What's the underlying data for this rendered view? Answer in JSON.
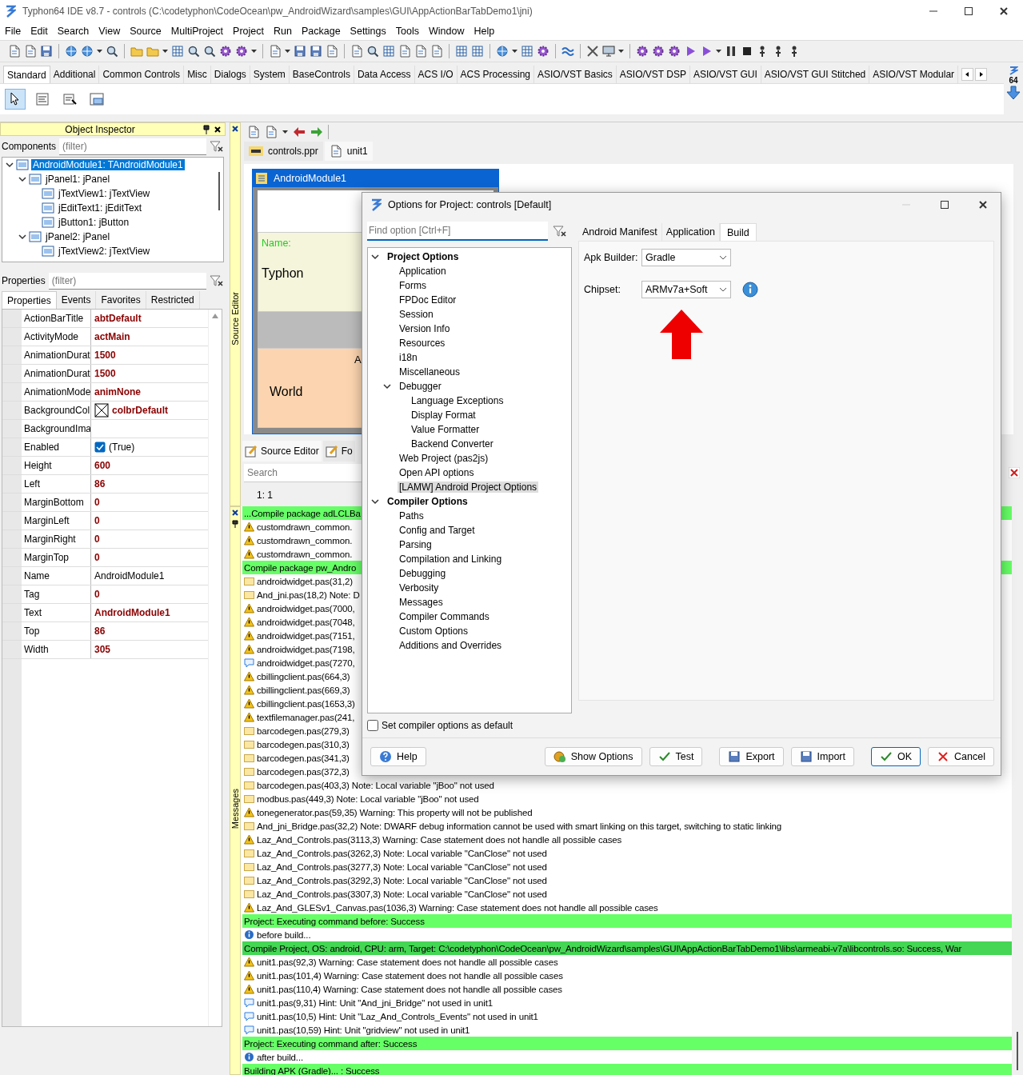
{
  "window": {
    "title": "Typhon64 IDE v8.7 - controls (C:\\codetyphon\\CodeOcean\\pw_AndroidWizard\\samples\\GUI\\AppActionBarTabDemo1\\jni)"
  },
  "menu": [
    "File",
    "Edit",
    "Search",
    "View",
    "Source",
    "MultiProject",
    "Project",
    "Run",
    "Package",
    "Settings",
    "Tools",
    "Window",
    "Help"
  ],
  "palette": {
    "tabs": [
      {
        "label": "Standard",
        "selected": true
      },
      {
        "label": "Additional",
        "selected": false
      },
      {
        "label": "Common Controls",
        "selected": false
      },
      {
        "label": "Misc",
        "selected": false
      },
      {
        "label": "Dialogs",
        "selected": false
      },
      {
        "label": "System",
        "selected": false
      },
      {
        "label": "BaseControls",
        "selected": false
      },
      {
        "label": "Data Access",
        "selected": false
      },
      {
        "label": "ACS I/O",
        "selected": false
      },
      {
        "label": "ACS Processing",
        "selected": false
      },
      {
        "label": "ASIO/VST Basics",
        "selected": false
      },
      {
        "label": "ASIO/VST DSP",
        "selected": false
      },
      {
        "label": "ASIO/VST GUI",
        "selected": false
      },
      {
        "label": "ASIO/VST GUI Stitched",
        "selected": false
      },
      {
        "label": "ASIO/VST Modular",
        "selected": false
      }
    ],
    "badge": "64",
    "components": [
      {
        "kind": "pointer",
        "selected": true
      },
      {
        "kind": "label",
        "selected": false
      },
      {
        "kind": "edit",
        "selected": false
      },
      {
        "kind": "button",
        "selected": false
      }
    ]
  },
  "object_inspector": {
    "title": "Object Inspector",
    "components_label": "Components",
    "components_filter": {
      "placeholder": "(filter)"
    },
    "tree": [
      {
        "label": "AndroidModule1: TAndroidModule1",
        "selected": true,
        "expanded": true,
        "children": [
          {
            "label": "jPanel1: jPanel",
            "selected": false,
            "expanded": true,
            "children": [
              {
                "label": "jTextView1: jTextView",
                "selected": false
              },
              {
                "label": "jEditText1: jEditText",
                "selected": false
              },
              {
                "label": "jButton1: jButton",
                "selected": false
              }
            ]
          },
          {
            "label": "jPanel2: jPanel",
            "selected": false,
            "expanded": true,
            "children": [
              {
                "label": "jTextView2: jTextView",
                "selected": false
              }
            ]
          }
        ]
      }
    ],
    "properties_label": "Properties",
    "properties_filter": {
      "placeholder": "(filter)"
    },
    "tabs": [
      {
        "label": "Properties",
        "selected": true
      },
      {
        "label": "Events",
        "selected": false
      },
      {
        "label": "Favorites",
        "selected": false
      },
      {
        "label": "Restricted",
        "selected": false
      }
    ],
    "properties": [
      {
        "name": "ActionBarTitle",
        "value": "abtDefault",
        "kind": "text",
        "modified": true
      },
      {
        "name": "ActivityMode",
        "value": "actMain",
        "kind": "text",
        "modified": true
      },
      {
        "name": "AnimationDurat",
        "value": "1500",
        "kind": "text",
        "modified": true
      },
      {
        "name": "AnimationDurat",
        "value": "1500",
        "kind": "text",
        "modified": true
      },
      {
        "name": "AnimationMode",
        "value": "animNone",
        "kind": "text",
        "modified": true
      },
      {
        "name": "BackgroundCol",
        "value": "colbrDefault",
        "kind": "color",
        "modified": true
      },
      {
        "name": "BackgroundIma",
        "kind": "text"
      },
      {
        "name": "Enabled",
        "value": "(True)",
        "kind": "check",
        "checked": true,
        "modified": false
      },
      {
        "name": "Height",
        "value": "600",
        "kind": "text",
        "modified": true
      },
      {
        "name": "Left",
        "value": "86",
        "kind": "text",
        "modified": true
      },
      {
        "name": "MarginBottom",
        "value": "0",
        "kind": "text",
        "modified": true
      },
      {
        "name": "MarginLeft",
        "value": "0",
        "kind": "text",
        "modified": true
      },
      {
        "name": "MarginRight",
        "value": "0",
        "kind": "text",
        "modified": true
      },
      {
        "name": "MarginTop",
        "value": "0",
        "kind": "text",
        "modified": true
      },
      {
        "name": "Name",
        "value": "AndroidModule1",
        "kind": "text",
        "modified": false
      },
      {
        "name": "Tag",
        "value": "0",
        "kind": "text",
        "modified": true
      },
      {
        "name": "Text",
        "value": "AndroidModule1",
        "kind": "text",
        "modified": true
      },
      {
        "name": "Top",
        "value": "86",
        "kind": "text",
        "modified": true
      },
      {
        "name": "Width",
        "value": "305",
        "kind": "text",
        "modified": true
      }
    ]
  },
  "source_editor": {
    "side_label": "Source Editor",
    "tabs": [
      {
        "label": "controls.ppr",
        "selected": false
      },
      {
        "label": "unit1",
        "selected": true
      }
    ],
    "form": {
      "title": "AndroidModule1",
      "name_label": "Name:",
      "text_1": "Typhon",
      "text_2": "A",
      "text_3": "World"
    },
    "bottom_tabs": [
      {
        "label": "Source Editor",
        "selected": true
      },
      {
        "label": "Fo",
        "selected": false
      }
    ],
    "search": {
      "placeholder": "Search"
    },
    "cursor_position": "1:  1"
  },
  "messages": {
    "side_label": "Messages",
    "rows": [
      {
        "kind": "banner",
        "color": "#66ff66",
        "text": "...Compile package adLCLBa"
      },
      {
        "kind": "warning",
        "text": "customdrawn_common."
      },
      {
        "kind": "warning",
        "text": "customdrawn_common."
      },
      {
        "kind": "warning",
        "text": "customdrawn_common."
      },
      {
        "kind": "banner",
        "color": "#66ff66",
        "text": "Compile package pw_Andro"
      },
      {
        "kind": "note",
        "text": "androidwidget.pas(31,2)"
      },
      {
        "kind": "note",
        "text": "And_jni.pas(18,2) Note: D"
      },
      {
        "kind": "warning",
        "text": "androidwidget.pas(7000,"
      },
      {
        "kind": "warning",
        "text": "androidwidget.pas(7048,"
      },
      {
        "kind": "warning",
        "text": "androidwidget.pas(7151,"
      },
      {
        "kind": "warning",
        "text": "androidwidget.pas(7198,"
      },
      {
        "kind": "hint",
        "text": "androidwidget.pas(7270,"
      },
      {
        "kind": "warning",
        "text": "cbillingclient.pas(664,3)"
      },
      {
        "kind": "warning",
        "text": "cbillingclient.pas(669,3)"
      },
      {
        "kind": "warning",
        "text": "cbillingclient.pas(1653,3)"
      },
      {
        "kind": "warning",
        "text": "textfilemanager.pas(241,"
      },
      {
        "kind": "note",
        "text": "barcodegen.pas(279,3)"
      },
      {
        "kind": "note",
        "text": "barcodegen.pas(310,3)"
      },
      {
        "kind": "note",
        "text": "barcodegen.pas(341,3)"
      },
      {
        "kind": "note",
        "text": "barcodegen.pas(372,3)"
      },
      {
        "kind": "note",
        "text": "barcodegen.pas(403,3) Note: Local variable \"jBoo\" not used"
      },
      {
        "kind": "note",
        "text": "modbus.pas(449,3) Note: Local variable \"jBoo\" not used"
      },
      {
        "kind": "warning",
        "text": "tonegenerator.pas(59,35) Warning: This property will not be published"
      },
      {
        "kind": "note",
        "text": "And_jni_Bridge.pas(32,2) Note: DWARF debug information cannot be used with smart linking on this target, switching to static linking"
      },
      {
        "kind": "warning",
        "text": "Laz_And_Controls.pas(3113,3) Warning: Case statement does not handle all possible cases"
      },
      {
        "kind": "note",
        "text": "Laz_And_Controls.pas(3262,3) Note: Local variable \"CanClose\" not used"
      },
      {
        "kind": "note",
        "text": "Laz_And_Controls.pas(3277,3) Note: Local variable \"CanClose\" not used"
      },
      {
        "kind": "note",
        "text": "Laz_And_Controls.pas(3292,3) Note: Local variable \"CanClose\" not used"
      },
      {
        "kind": "note",
        "text": "Laz_And_Controls.pas(3307,3) Note: Local variable \"CanClose\" not used"
      },
      {
        "kind": "warning",
        "text": "Laz_And_GLESv1_Canvas.pas(1036,3) Warning: Case statement does not handle all possible cases"
      },
      {
        "kind": "banner",
        "color": "#66ff66",
        "text": "Project: Executing command before: Success"
      },
      {
        "kind": "info",
        "text": "before build..."
      },
      {
        "kind": "banner",
        "color": "#44d654",
        "text": "Compile Project, OS: android, CPU: arm, Target: C:\\codetyphon\\CodeOcean\\pw_AndroidWizard\\samples\\GUI\\AppActionBarTabDemo1\\libs\\armeabi-v7a\\libcontrols.so: Success, War"
      },
      {
        "kind": "warning",
        "text": "unit1.pas(92,3) Warning: Case statement does not handle all possible cases"
      },
      {
        "kind": "warning",
        "text": "unit1.pas(101,4) Warning: Case statement does not handle all possible cases"
      },
      {
        "kind": "warning",
        "text": "unit1.pas(110,4) Warning: Case statement does not handle all possible cases"
      },
      {
        "kind": "hint",
        "text": "unit1.pas(9,31) Hint: Unit \"And_jni_Bridge\" not used in unit1"
      },
      {
        "kind": "hint",
        "text": "unit1.pas(10,5) Hint: Unit \"Laz_And_Controls_Events\" not used in unit1"
      },
      {
        "kind": "hint",
        "text": "unit1.pas(10,59) Hint: Unit \"gridview\" not used in unit1"
      },
      {
        "kind": "banner",
        "color": "#66ff66",
        "text": "Project: Executing command after: Success"
      },
      {
        "kind": "info",
        "text": "after build..."
      },
      {
        "kind": "banner",
        "color": "#66ff66",
        "text": "Building APK (Gradle)... : Success"
      }
    ]
  },
  "dialog": {
    "title": "Options for Project: controls [Default]",
    "find": {
      "placeholder": "Find option [Ctrl+F]"
    },
    "tree": [
      {
        "label": "Project Options",
        "selected": false,
        "expanded": true,
        "children": [
          {
            "label": "Application",
            "selected": false
          },
          {
            "label": "Forms",
            "selected": false
          },
          {
            "label": "FPDoc Editor",
            "selected": false
          },
          {
            "label": "Session",
            "selected": false
          },
          {
            "label": "Version Info",
            "selected": false
          },
          {
            "label": "Resources",
            "selected": false
          },
          {
            "label": "i18n",
            "selected": false
          },
          {
            "label": "Miscellaneous",
            "selected": false
          },
          {
            "label": "Debugger",
            "selected": false,
            "expanded": true,
            "children": [
              {
                "label": "Language Exceptions",
                "selected": false
              },
              {
                "label": "Display Format",
                "selected": false
              },
              {
                "label": "Value Formatter",
                "selected": false
              },
              {
                "label": "Backend Converter",
                "selected": false
              }
            ]
          },
          {
            "label": "Web Project (pas2js)",
            "selected": false
          },
          {
            "label": "Open API options",
            "selected": false
          },
          {
            "label": "[LAMW] Android Project Options",
            "selected": true
          }
        ]
      },
      {
        "label": "Compiler Options",
        "selected": false,
        "expanded": true,
        "children": [
          {
            "label": "Paths",
            "selected": false
          },
          {
            "label": "Config and Target",
            "selected": false
          },
          {
            "label": "Parsing",
            "selected": false
          },
          {
            "label": "Compilation and Linking",
            "selected": false
          },
          {
            "label": "Debugging",
            "selected": false
          },
          {
            "label": "Verbosity",
            "selected": false
          },
          {
            "label": "Messages",
            "selected": false
          },
          {
            "label": "Compiler Commands",
            "selected": false
          },
          {
            "label": "Custom Options",
            "selected": false
          },
          {
            "label": "Additions and Overrides",
            "selected": false
          }
        ]
      }
    ],
    "default_checkbox": {
      "label": "Set compiler options as default",
      "checked": false
    },
    "tabs": [
      {
        "label": "Android Manifest",
        "selected": false
      },
      {
        "label": "Application",
        "selected": false
      },
      {
        "label": "Build",
        "selected": true
      }
    ],
    "fields": [
      {
        "label": "Apk Builder:",
        "value": "Gradle"
      },
      {
        "label": "Chipset:",
        "value": "ARMv7a+Soft",
        "info": true
      }
    ],
    "buttons": [
      {
        "label": "Help",
        "kind": "help",
        "default": false
      },
      {
        "label": "Show Options",
        "kind": "show",
        "default": false
      },
      {
        "label": "Test",
        "kind": "test",
        "default": false
      },
      {
        "label": "Export",
        "kind": "export",
        "default": false
      },
      {
        "label": "Import",
        "kind": "import",
        "default": false
      },
      {
        "label": "OK",
        "kind": "ok",
        "default": true
      },
      {
        "label": "Cancel",
        "kind": "cancel",
        "default": false
      }
    ]
  }
}
